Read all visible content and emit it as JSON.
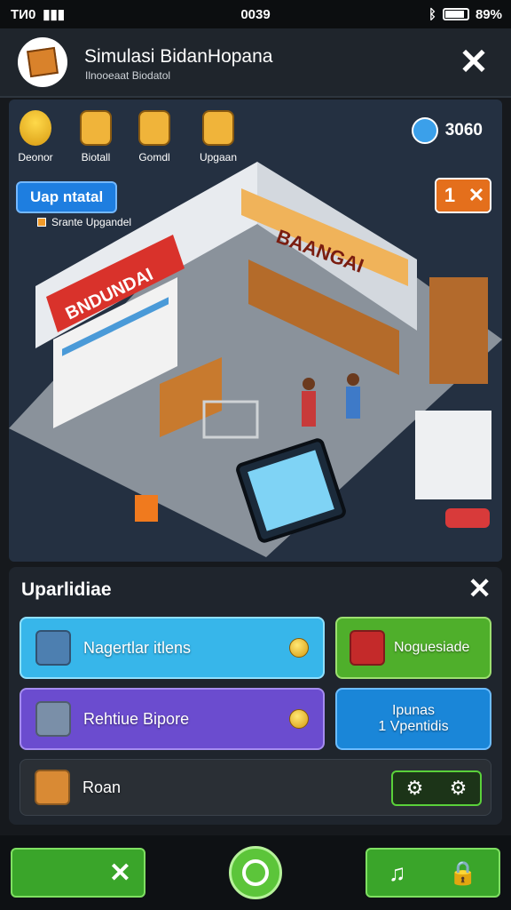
{
  "status_bar": {
    "carrier": "TИ0",
    "time": "0039",
    "battery": "89%"
  },
  "header": {
    "title": "Simulasi BidanHopana",
    "subtitle": "Ilnooeaat Biodatol",
    "close_symbol": "✕"
  },
  "resources": [
    {
      "label": "Deonor",
      "icon": "coins-icon"
    },
    {
      "label": "Biotall",
      "icon": "crate-icon"
    },
    {
      "label": "Gomdl",
      "icon": "crate-icon"
    },
    {
      "label": "Upgaan",
      "icon": "crate-icon"
    }
  ],
  "level": {
    "value": "3060",
    "icon": "avatar-icon"
  },
  "scene": {
    "update_button": "Uap ntatal",
    "update_note": "Srante Upgandel",
    "badge_number": "1",
    "badge_close": "✕",
    "sign_left": "BNDUNDAI",
    "sign_center": "BAANGAI"
  },
  "upgrade_panel": {
    "title": "Uparlidiae",
    "close_symbol": "✕",
    "items": [
      {
        "label": "Nagertlar itlens",
        "icon": "gear-box-icon"
      },
      {
        "label": "Noguesiade",
        "icon": "red-box-icon"
      },
      {
        "label": "Rehtiue Bipore",
        "icon": "storage-box-icon"
      },
      {
        "label": "Ipunas",
        "label2": "1 Vpentidis"
      },
      {
        "label": "Roan",
        "icon": "crate-icon"
      }
    ],
    "toggle_icons": [
      "gear-icon",
      "gear-icon"
    ]
  },
  "bottom_bar": {
    "close_symbol": "✕",
    "music_symbol": "♫",
    "lock_symbol": "🔒"
  },
  "colors": {
    "accent_green": "#3aa52a",
    "accent_blue": "#37b6ea",
    "accent_purple": "#6b4ccf",
    "accent_orange": "#e46f1c"
  }
}
